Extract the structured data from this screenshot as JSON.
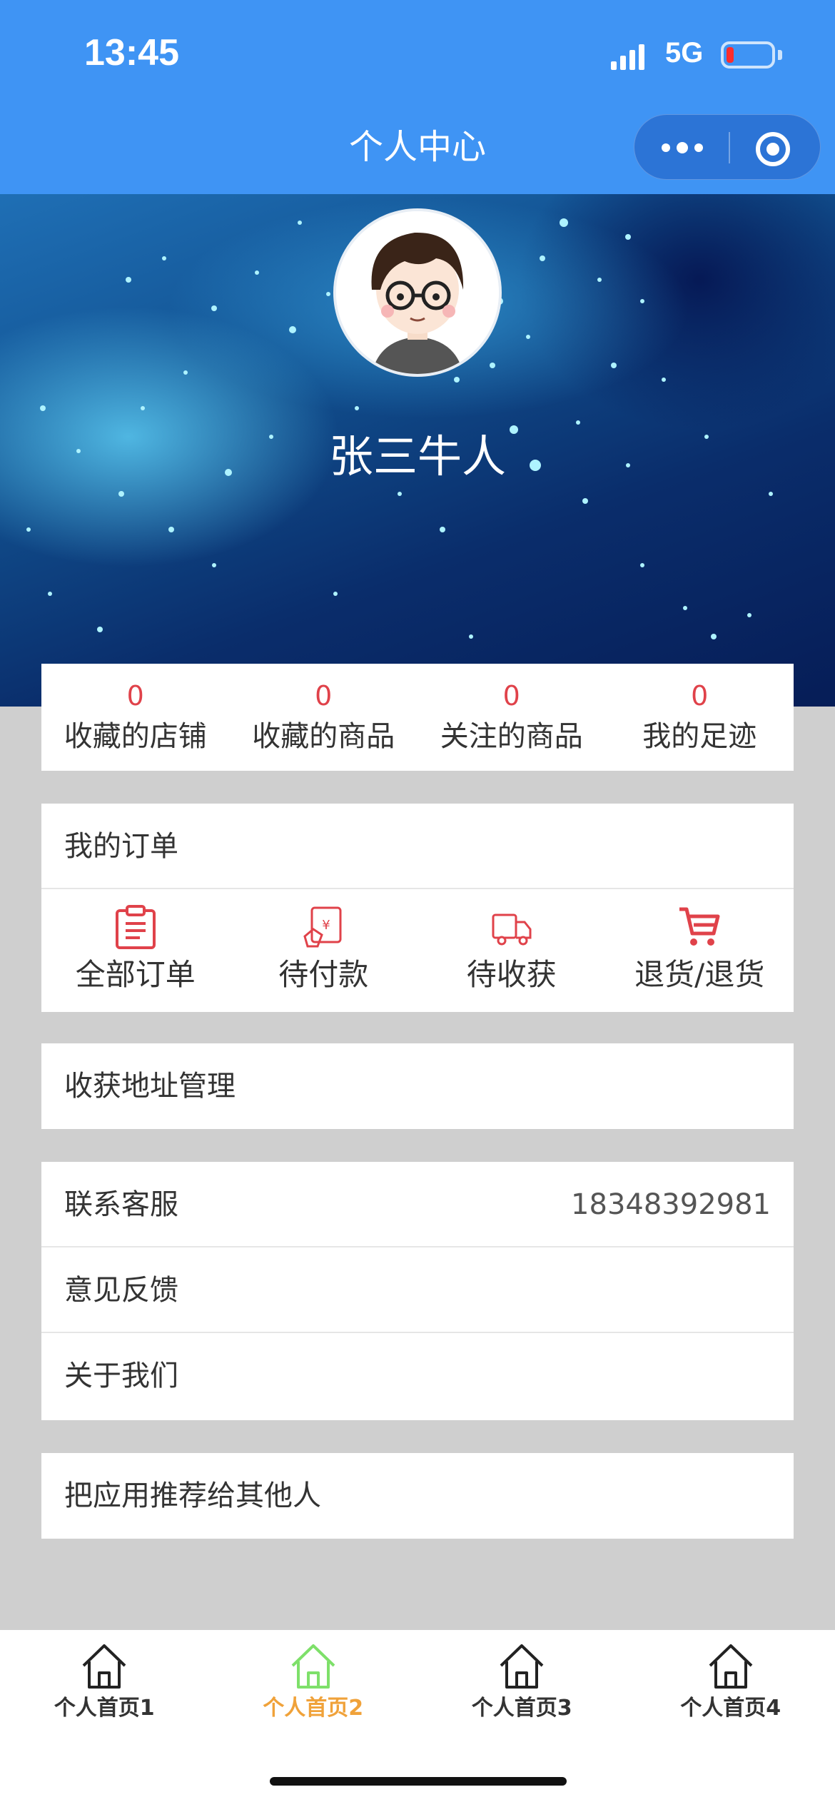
{
  "status_bar": {
    "time": "13:45",
    "network": "5G"
  },
  "nav": {
    "title": "个人中心"
  },
  "profile": {
    "name": "张三牛人",
    "avatar_icon": "cartoon-avatar-icon"
  },
  "stats": [
    {
      "count": "0",
      "label": "收藏的店铺"
    },
    {
      "count": "0",
      "label": "收藏的商品"
    },
    {
      "count": "0",
      "label": "关注的商品"
    },
    {
      "count": "0",
      "label": "我的足迹"
    }
  ],
  "orders": {
    "title": "我的订单",
    "items": [
      {
        "label": "全部订单",
        "icon": "clipboard-icon"
      },
      {
        "label": "待付款",
        "icon": "payment-icon"
      },
      {
        "label": "待收获",
        "icon": "truck-icon"
      },
      {
        "label": "退货/退货",
        "icon": "cart-icon"
      }
    ]
  },
  "address": {
    "label": "收获地址管理"
  },
  "support": {
    "contact_label": "联系客服",
    "contact_phone": "18348392981",
    "feedback_label": "意见反馈",
    "about_label": "关于我们"
  },
  "recommend": {
    "label": "把应用推荐给其他人"
  },
  "tabbar": {
    "items": [
      {
        "label": "个人首页1",
        "icon": "home-icon"
      },
      {
        "label": "个人首页2",
        "icon": "home-icon",
        "active": true
      },
      {
        "label": "个人首页3",
        "icon": "home-icon"
      },
      {
        "label": "个人首页4",
        "icon": "home-icon"
      }
    ]
  },
  "colors": {
    "header_blue": "#3f94f4",
    "accent_red": "#e0424a",
    "active_tab_text": "#f0a23a",
    "active_tab_icon": "#7ee06a"
  }
}
